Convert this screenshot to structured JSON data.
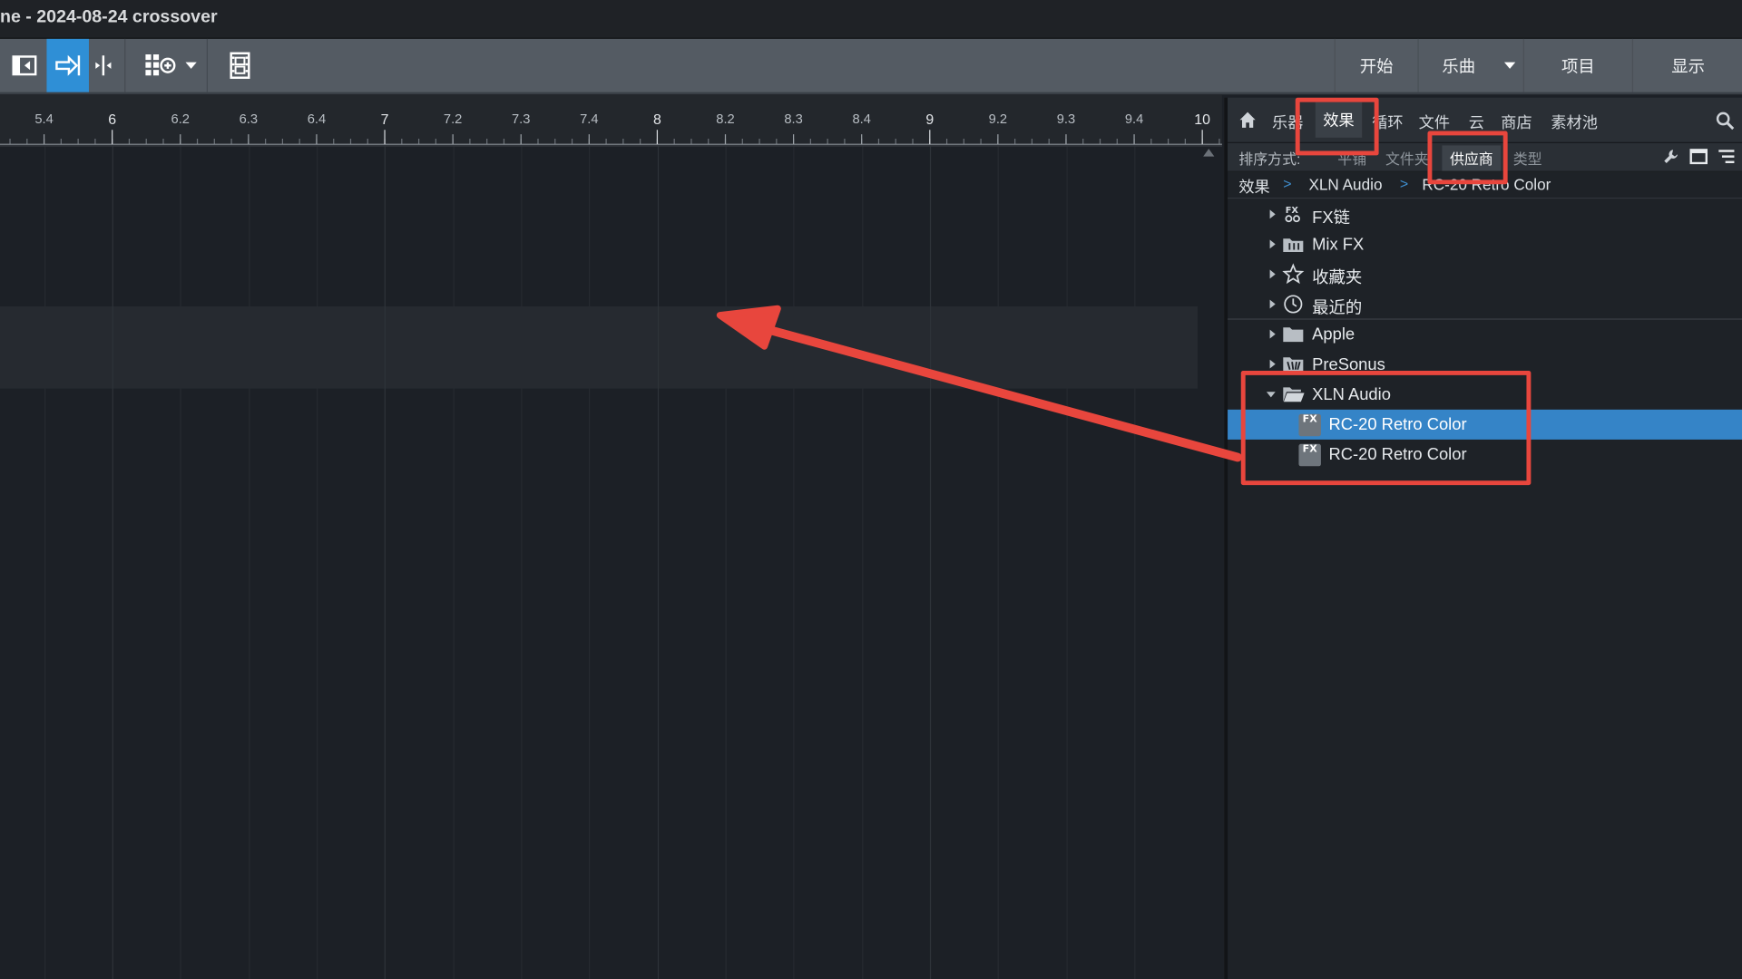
{
  "window": {
    "title": "ne - 2024-08-24 crossover"
  },
  "toolbar": {
    "nav": [
      "开始",
      "乐曲",
      "项目",
      "显示"
    ]
  },
  "ruler": {
    "labels": [
      "5.4",
      "6",
      "6.2",
      "6.3",
      "6.4",
      "7",
      "7.2",
      "7.3",
      "7.4",
      "8",
      "8.2",
      "8.3",
      "8.4",
      "9",
      "9.2",
      "9.3",
      "9.4",
      "10"
    ]
  },
  "browser": {
    "tabs": {
      "instruments": "乐器",
      "effects": "效果",
      "loops": "循环",
      "files": "文件",
      "cloud": "云",
      "store": "商店",
      "pool": "素材池"
    },
    "sort": {
      "label": "排序方式:",
      "flat": "平铺",
      "folder": "文件夹",
      "vendor": "供应商",
      "type": "类型"
    },
    "breadcrumb": {
      "root": "效果",
      "vendor": "XLN Audio",
      "plugin": "RC-20 Retro Color"
    },
    "tree": {
      "fx_chain": "FX链",
      "mix_fx": "Mix FX",
      "favorites": "收藏夹",
      "recent": "最近的",
      "apple": "Apple",
      "presonus": "PreSonus",
      "xln_audio": "XLN Audio",
      "plugin_vst": "RC-20 Retro Color",
      "plugin_au": "RC-20 Retro Color",
      "fx_badge": "FX"
    }
  },
  "colors": {
    "accent_blue": "#2f8fd6",
    "selection": "#3584c7",
    "annotation_red": "#e8463d"
  }
}
